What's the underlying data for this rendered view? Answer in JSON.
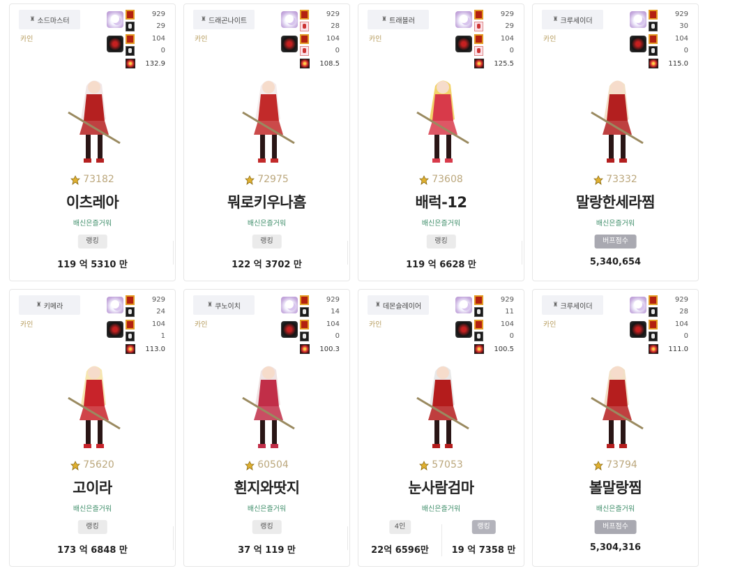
{
  "cards": [
    {
      "job": "소드마스터",
      "server": "카인",
      "stats": [
        "929",
        "29",
        "104",
        "0"
      ],
      "power": "132.9",
      "fame": "73182",
      "name": "이츠레아",
      "guild": "배신은즐거워",
      "badge": "랭킹",
      "score": "119 억 5310 만",
      "palette": {
        "main": "#b52020",
        "hair": "#f1e6e6"
      }
    },
    {
      "job": "드래곤나이트",
      "server": "카인",
      "stats": [
        "929",
        "28",
        "104",
        "0"
      ],
      "power": "108.5",
      "fame": "72975",
      "name": "뭐로키우나흠",
      "guild": "배신은즐거워",
      "badge": "랭킹",
      "score": "122 억 3702 만",
      "palette": {
        "main": "#c22a2a",
        "hair": "#f4ecec"
      }
    },
    {
      "job": "트래블러",
      "server": "카인",
      "stats": [
        "929",
        "29",
        "104",
        "0"
      ],
      "power": "125.5",
      "fame": "73608",
      "name": "배럭-12",
      "guild": "배신은즐거워",
      "badge": "랭킹",
      "score": "119 억 6628 만",
      "palette": {
        "main": "#d83a4a",
        "hair": "#f2d36a"
      }
    },
    {
      "job": "크루세이더",
      "server": "카인",
      "stats": [
        "929",
        "30",
        "104",
        "0"
      ],
      "power": "115.0",
      "fame": "73332",
      "name": "말랑한세라찜",
      "guild": "배신은즐거워",
      "badge": "버프점수",
      "score": "5,340,654",
      "palette": {
        "main": "#b31f1f",
        "hair": "#f3e0c8"
      }
    },
    {
      "job": "키메라",
      "server": "카인",
      "stats": [
        "929",
        "24",
        "104",
        "1"
      ],
      "power": "113.0",
      "fame": "75620",
      "name": "고이라",
      "guild": "배신은즐거워",
      "badge": "랭킹",
      "score": "173 억 6848 만",
      "palette": {
        "main": "#c8232a",
        "hair": "#f6e6b0"
      }
    },
    {
      "job": "쿠노이치",
      "server": "카인",
      "stats": [
        "929",
        "14",
        "104",
        "0"
      ],
      "power": "100.3",
      "fame": "60504",
      "name": "흰지와땃지",
      "guild": "배신은즐거워",
      "badge": "랭킹",
      "score": "37 억 119 만",
      "palette": {
        "main": "#c12e48",
        "hair": "#efe3e3"
      }
    },
    {
      "job": "데몬슬레이어",
      "server": "카인",
      "stats": [
        "929",
        "11",
        "104",
        "0"
      ],
      "power": "100.5",
      "fame": "57053",
      "name": "눈사람검마",
      "guild": "배신은즐거워",
      "split": [
        {
          "badge": "4인",
          "score": "22억 6596만"
        },
        {
          "badge": "랭킹",
          "score": "19 억 7358 만"
        }
      ],
      "palette": {
        "main": "#b41c1c",
        "hair": "#e8e8e8"
      }
    },
    {
      "job": "크루세이더",
      "server": "카인",
      "stats": [
        "929",
        "28",
        "104",
        "0"
      ],
      "power": "111.0",
      "fame": "73794",
      "name": "볼말랑찜",
      "guild": "배신은즐거워",
      "badge": "버프점수",
      "score": "5,304,316",
      "palette": {
        "main": "#b51e1e",
        "hair": "#f2dfc6"
      }
    }
  ]
}
